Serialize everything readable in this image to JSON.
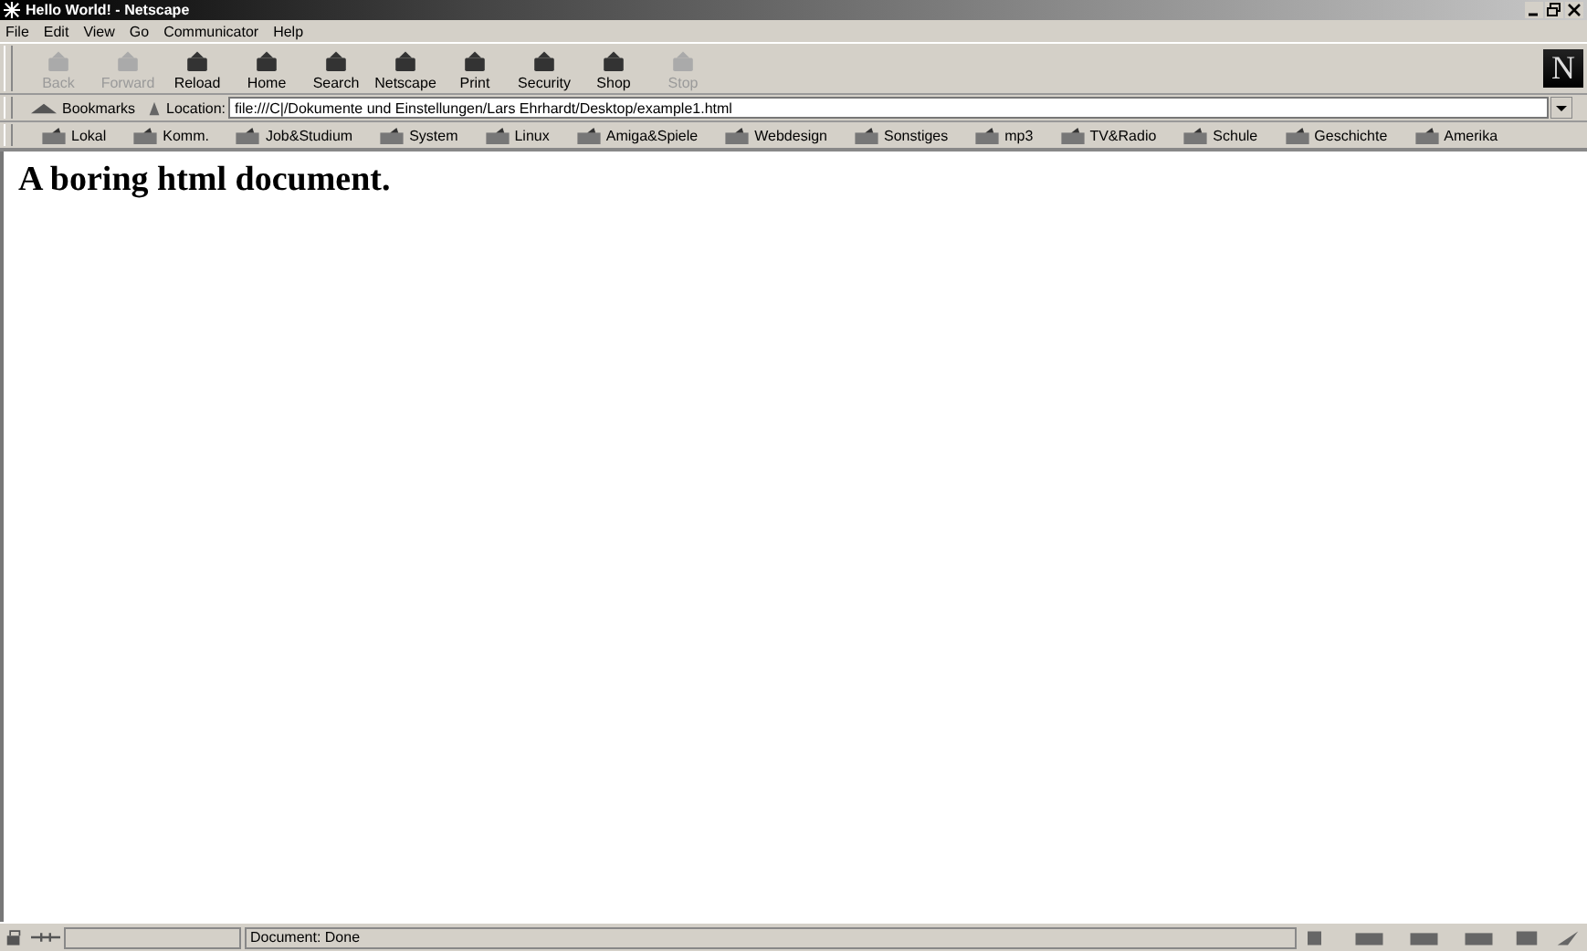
{
  "window": {
    "title": "Hello World! - Netscape"
  },
  "menu": [
    "File",
    "Edit",
    "View",
    "Go",
    "Communicator",
    "Help"
  ],
  "toolbar": [
    {
      "label": "Back",
      "disabled": true
    },
    {
      "label": "Forward",
      "disabled": true
    },
    {
      "label": "Reload",
      "disabled": false
    },
    {
      "label": "Home",
      "disabled": false
    },
    {
      "label": "Search",
      "disabled": false
    },
    {
      "label": "Netscape",
      "disabled": false
    },
    {
      "label": "Print",
      "disabled": false
    },
    {
      "label": "Security",
      "disabled": false
    },
    {
      "label": "Shop",
      "disabled": false
    },
    {
      "label": "Stop",
      "disabled": true
    }
  ],
  "logo": "N",
  "location": {
    "bookmarks": "Bookmarks",
    "label": "Location:",
    "value": "file:///C|/Dokumente und Einstellungen/Lars Ehrhardt/Desktop/example1.html"
  },
  "personal_toolbar": [
    "Lokal",
    "Komm.",
    "Job&Studium",
    "System",
    "Linux",
    "Amiga&Spiele",
    "Webdesign",
    "Sonstiges",
    "mp3",
    "TV&Radio",
    "Schule",
    "Geschichte",
    "Amerika"
  ],
  "page": {
    "heading": "A boring html document."
  },
  "status_bar": {
    "text": "Document: Done"
  }
}
